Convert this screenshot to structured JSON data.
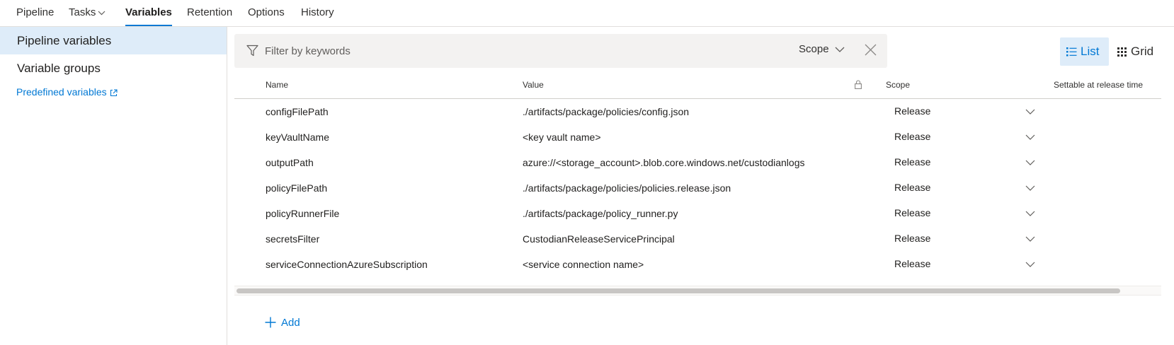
{
  "tabs": [
    {
      "label": "Pipeline"
    },
    {
      "label": "Tasks"
    },
    {
      "label": "Variables"
    },
    {
      "label": "Retention"
    },
    {
      "label": "Options"
    },
    {
      "label": "History"
    }
  ],
  "sidebar": {
    "items": [
      {
        "label": "Pipeline variables"
      },
      {
        "label": "Variable groups"
      }
    ],
    "link": "Predefined variables"
  },
  "filter": {
    "placeholder": "Filter by keywords",
    "scope_label": "Scope"
  },
  "view": {
    "list_label": "List",
    "grid_label": "Grid"
  },
  "table": {
    "headers": {
      "name": "Name",
      "value": "Value",
      "scope": "Scope",
      "settable": "Settable at release time"
    },
    "rows": [
      {
        "name": "configFilePath",
        "value": "./artifacts/package/policies/config.json",
        "scope": "Release"
      },
      {
        "name": "keyVaultName",
        "value": "<key vault name>",
        "scope": "Release"
      },
      {
        "name": "outputPath",
        "value": "azure://<storage_account>.blob.core.windows.net/custodianlogs",
        "scope": "Release"
      },
      {
        "name": "policyFilePath",
        "value": "./artifacts/package/policies/policies.release.json",
        "scope": "Release"
      },
      {
        "name": "policyRunnerFile",
        "value": "./artifacts/package/policy_runner.py",
        "scope": "Release"
      },
      {
        "name": "secretsFilter",
        "value": "CustodianReleaseServicePrincipal",
        "scope": "Release"
      },
      {
        "name": "serviceConnectionAzureSubscription",
        "value": "<service connection name>",
        "scope": "Release"
      }
    ]
  },
  "add_label": "Add",
  "colors": {
    "accent": "#0078d4",
    "selected_bg": "#deecf9",
    "filter_bg": "#f3f2f1"
  }
}
